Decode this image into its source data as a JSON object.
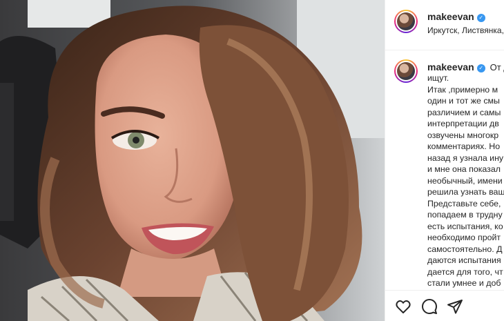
{
  "post": {
    "photo": {
      "alt_icon": "selfie-photo"
    },
    "author": {
      "username": "makeevan",
      "verified_icon": "verified-badge-icon",
      "location": "Иркутск, Листвянка, С"
    },
    "caption": {
      "username": "makeevan",
      "first_line_rest": "От до",
      "lines": [
        "ищут.",
        "Итак ,примерно м",
        "один и тот же смы",
        "различием и самы",
        "интерпретации дв",
        "озвучены многокр",
        "комментариях. Но",
        "назад я узнала ину",
        "и мне она показал",
        "необычный, имени",
        "решила узнать ваш",
        "Представьте себе,",
        "попадаем в трудну",
        "есть испытания, ко",
        "необходимо пройт",
        "самостоятельно. Д",
        "даются испытания",
        "дается для того, чт",
        "стали умнее и доб"
      ]
    },
    "actions": {
      "like_icon": "heart-icon",
      "comment_icon": "comment-icon",
      "share_icon": "share-icon"
    }
  },
  "colors": {
    "verified": "#3897f0",
    "text": "#262626",
    "divider": "#efefef"
  }
}
